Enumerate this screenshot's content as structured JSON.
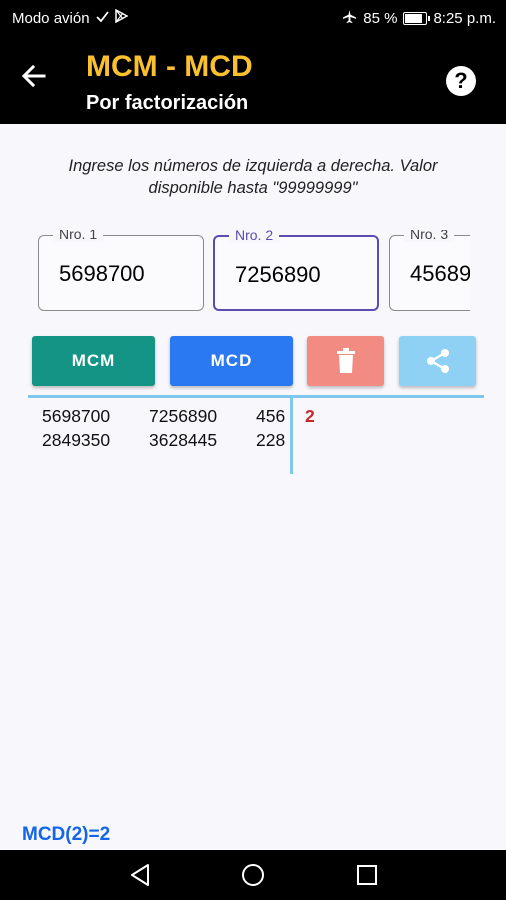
{
  "status_bar": {
    "left_text": "Modo avión",
    "battery": "85 %",
    "time": "8:25 p.m."
  },
  "app_bar": {
    "title": "MCM - MCD",
    "subtitle": "Por factorización"
  },
  "instructions": "Ingrese los números de izquierda a derecha. Valor disponible hasta \"99999999\"",
  "inputs": [
    {
      "label": "Nro. 1",
      "value": "5698700"
    },
    {
      "label": "Nro. 2",
      "value": "7256890"
    },
    {
      "label": "Nro. 3",
      "value": "45689"
    }
  ],
  "buttons": {
    "mcm": "MCM",
    "mcd": "MCD"
  },
  "factorization": {
    "rows": [
      [
        "5698700",
        "7256890",
        "456"
      ],
      [
        "2849350",
        "3628445",
        "228"
      ]
    ],
    "factor": "2"
  },
  "result": "MCD(2)=2",
  "colors": {
    "title": "#fbc02d",
    "mcm_button": "#139485",
    "mcd_button": "#2a78f2",
    "delete_button": "#f28b82",
    "share_button": "#8fd0f5",
    "factor": "#c62828",
    "result": "#1565e8",
    "focused_field": "#5c4bb0"
  },
  "icons": {
    "status": [
      "check-icon",
      "play-store-icon",
      "airplane-icon",
      "battery-icon"
    ],
    "app_bar": [
      "back-arrow-icon",
      "help-icon"
    ],
    "buttons": [
      "trash-icon",
      "share-icon"
    ],
    "nav": [
      "nav-back-icon",
      "nav-home-icon",
      "nav-recents-icon"
    ]
  }
}
